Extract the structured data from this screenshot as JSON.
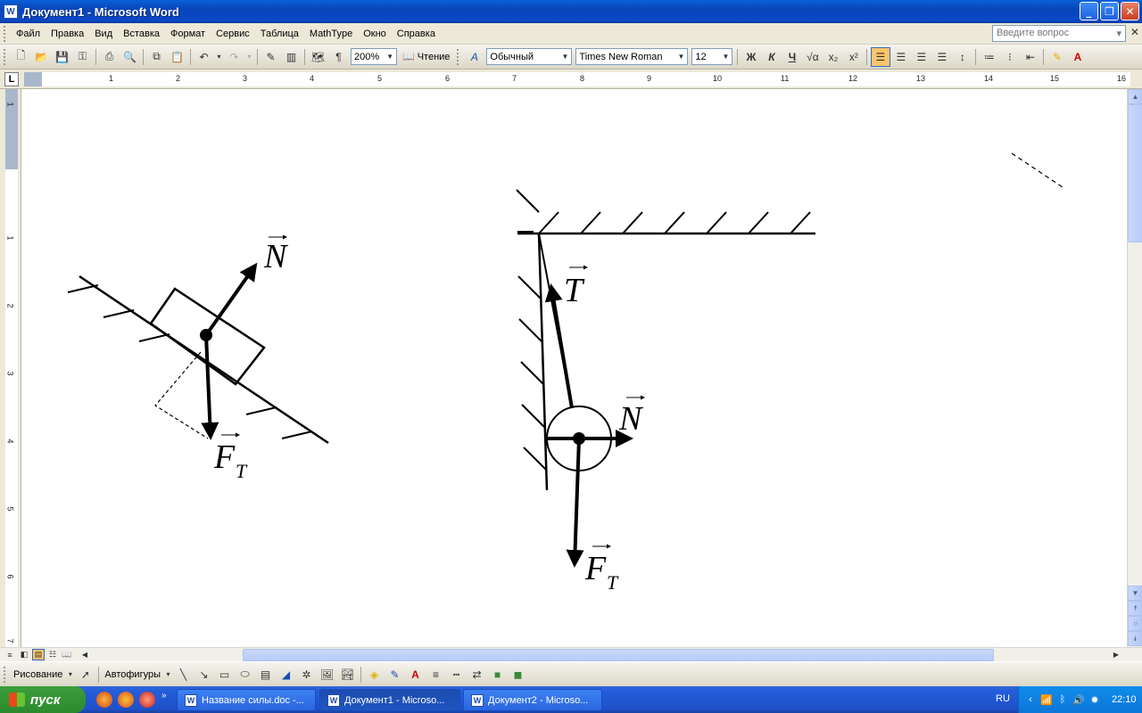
{
  "window": {
    "title": "Документ1 - Microsoft Word",
    "app_icon": "word-icon"
  },
  "menu": {
    "items": [
      "Файл",
      "Правка",
      "Вид",
      "Вставка",
      "Формат",
      "Сервис",
      "Таблица",
      "MathType",
      "Окно",
      "Справка"
    ],
    "help_placeholder": "Введите вопрос"
  },
  "toolbar": {
    "zoom": "200%",
    "reading_label": "Чтение",
    "style": "Обычный",
    "font": "Times New Roman",
    "font_size": "12",
    "bold": "Ж",
    "italic": "К",
    "underline": "Ч"
  },
  "ruler": {
    "corner": "L",
    "h_numbers": [
      "1",
      "2",
      "1",
      "2",
      "3",
      "4",
      "5",
      "6",
      "7",
      "8",
      "9",
      "10",
      "11",
      "12",
      "13",
      "14",
      "15",
      "16"
    ],
    "v_numbers": [
      "1",
      "1",
      "2",
      "3",
      "4",
      "5",
      "6",
      "7"
    ]
  },
  "figure": {
    "labels": {
      "n_incline": "N",
      "ft_incline": "F",
      "ft_incline_sub": "T",
      "t_wall": "T",
      "n_wall": "N",
      "ft_wall": "F",
      "ft_wall_sub": "T"
    }
  },
  "drawing_toolbar": {
    "draw_label": "Рисование",
    "autoshapes_label": "Автофигуры"
  },
  "taskbar": {
    "start_label": "пуск",
    "tasks": [
      "Название силы.doc -...",
      "Документ1 - Microso...",
      "Документ2 - Microso..."
    ],
    "language": "RU",
    "clock": "22:10"
  }
}
